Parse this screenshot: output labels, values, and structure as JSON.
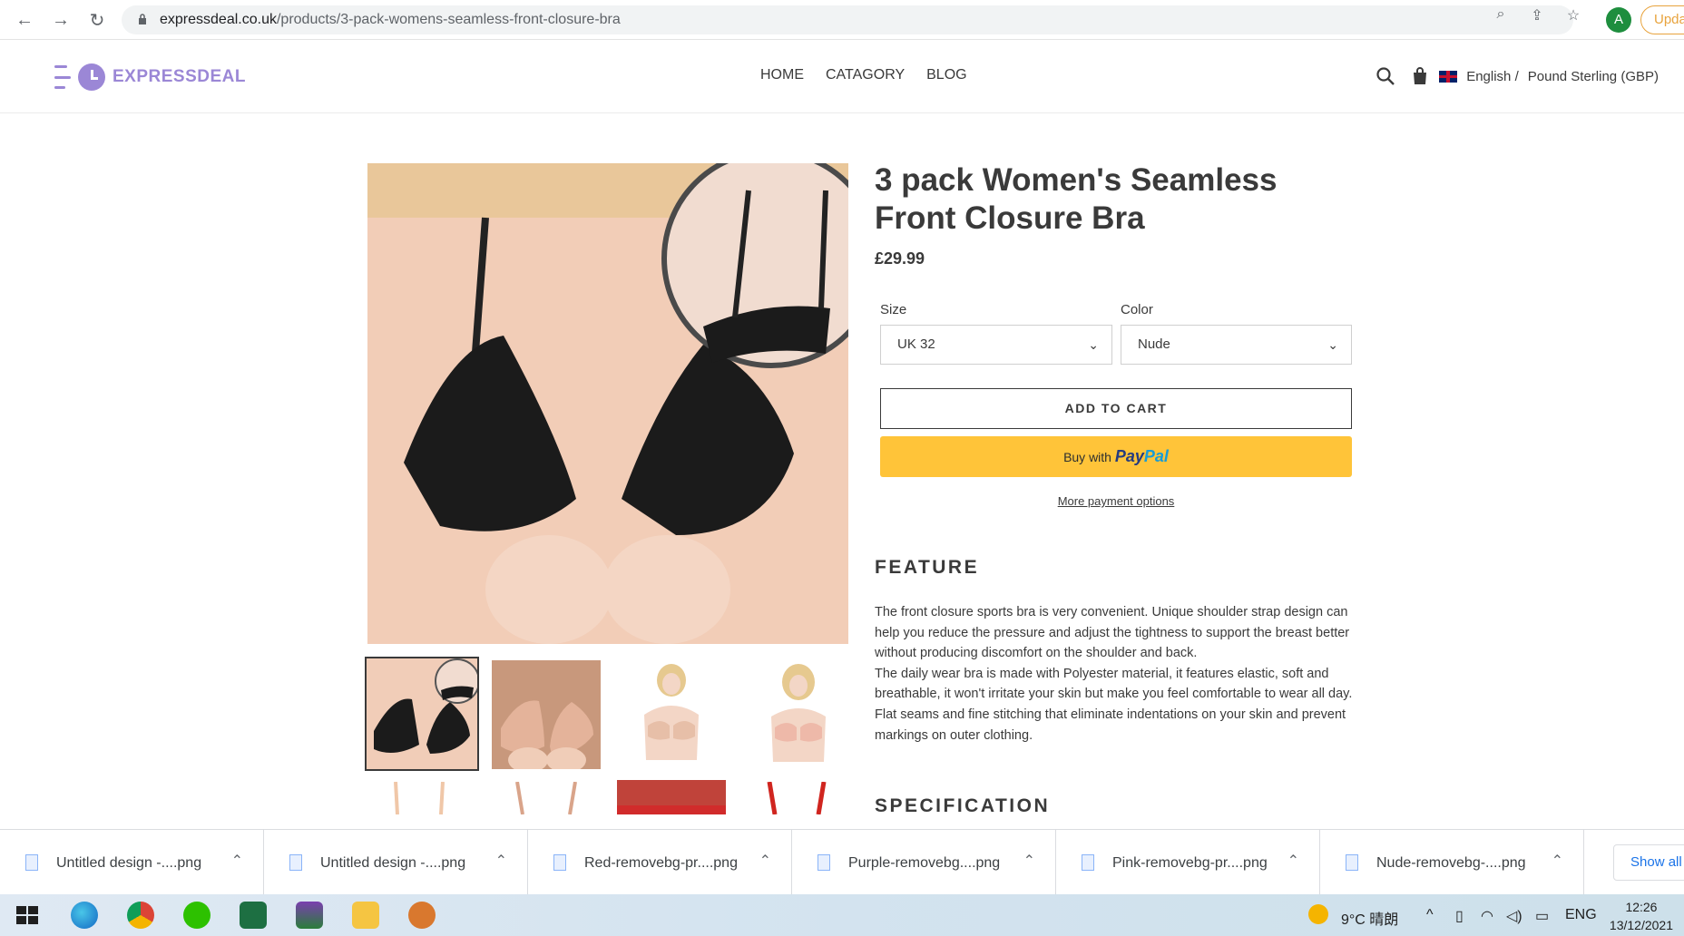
{
  "browser": {
    "url_domain": "expressdeal.co.uk",
    "url_path": "/products/3-pack-womens-seamless-front-closure-bra",
    "profile_initial": "A",
    "update_label": "Upda"
  },
  "site": {
    "logo_text": "EXPRESSDEAL",
    "brand_color": "#9b87d6",
    "nav": [
      "HOME",
      "CATAGORY",
      "BLOG"
    ],
    "language": "English /",
    "currency": "Pound Sterling (GBP)"
  },
  "product": {
    "title": "3 pack Women's Seamless Front Closure Bra",
    "price": "£29.99",
    "size_label": "Size",
    "size_value": "UK 32",
    "color_label": "Color",
    "color_value": "Nude",
    "add_to_cart": "ADD TO CART",
    "paypal_prefix": "Buy with",
    "paypal_brand_1": "Pay",
    "paypal_brand_2": "Pal",
    "more_payment": "More payment options",
    "feature_heading": "FEATURE",
    "feature_p1": "The front closure sports bra is very convenient. Unique shoulder strap design can help you reduce the pressure and adjust the tightness to support the breast better without producing discomfort on the shoulder and back.",
    "feature_p2": "The daily wear bra is made with Polyester material, it features elastic, soft and breathable, it won't irritate your skin but make you feel comfortable to wear all day. Flat seams and fine stitching that eliminate indentations on your skin and prevent markings on outer clothing.",
    "spec_heading": "SPECIFICATION"
  },
  "downloads": {
    "items": [
      "Untitled design -....png",
      "Untitled design -....png",
      "Red-removebg-pr....png",
      "Purple-removebg....png",
      "Pink-removebg-pr....png",
      "Nude-removebg-....png"
    ],
    "show_all": "Show all"
  },
  "taskbar": {
    "weather": "9°C 晴朗",
    "lang": "ENG",
    "time": "12:26",
    "date": "13/12/2021"
  }
}
